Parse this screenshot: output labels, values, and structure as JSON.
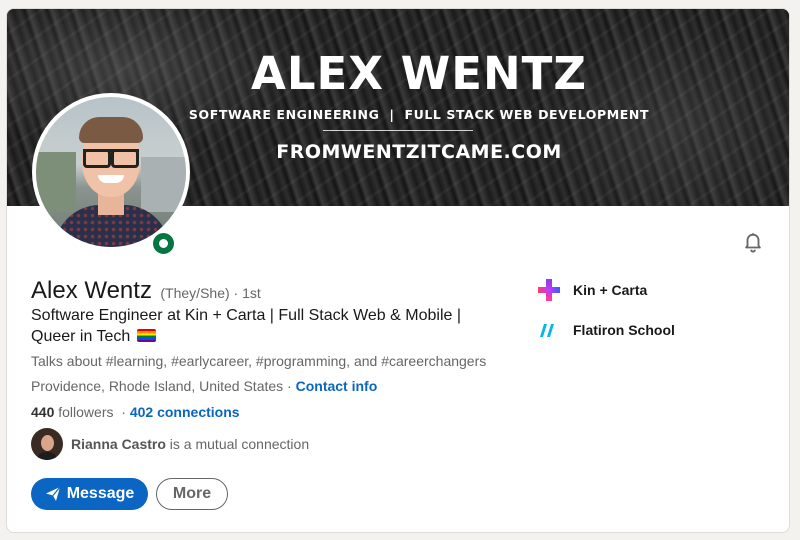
{
  "banner": {
    "title": "ALEX WENTZ",
    "tagline": "SOFTWARE ENGINEERING  |  FULL STACK WEB DEVELOPMENT",
    "url": "FROMWENTZITCAME.COM"
  },
  "profile": {
    "name": "Alex Wentz",
    "pronouns": "(They/She)",
    "degree": " · 1st",
    "headline": "Software Engineer at Kin + Carta | Full Stack Web & Mobile | Queer in Tech",
    "talks_about": "Talks about #learning, #earlycareer, #programming, and #careerchangers",
    "location": "Providence, Rhode Island, United States",
    "location_sep": " · ",
    "contact_info": "Contact info",
    "followers_count": "440",
    "followers_label": " followers",
    "connections_sep": "  · ",
    "connections": "402 connections",
    "mutual_name": "Rianna Castro",
    "mutual_suffix": " is a mutual connection",
    "online_status": "online"
  },
  "actions": {
    "message_label": "Message",
    "more_label": "More"
  },
  "organizations": [
    {
      "name": "Kin + Carta",
      "icon": "kin-carta-logo"
    },
    {
      "name": "Flatiron School",
      "icon": "flatiron-logo"
    }
  ],
  "colors": {
    "primary": "#0a66c2",
    "online": "#057642",
    "text": "#191919",
    "muted": "#666666"
  },
  "icons": {
    "notify": "bell-icon",
    "send": "paper-plane-icon",
    "pride": "pride-flag-icon"
  }
}
